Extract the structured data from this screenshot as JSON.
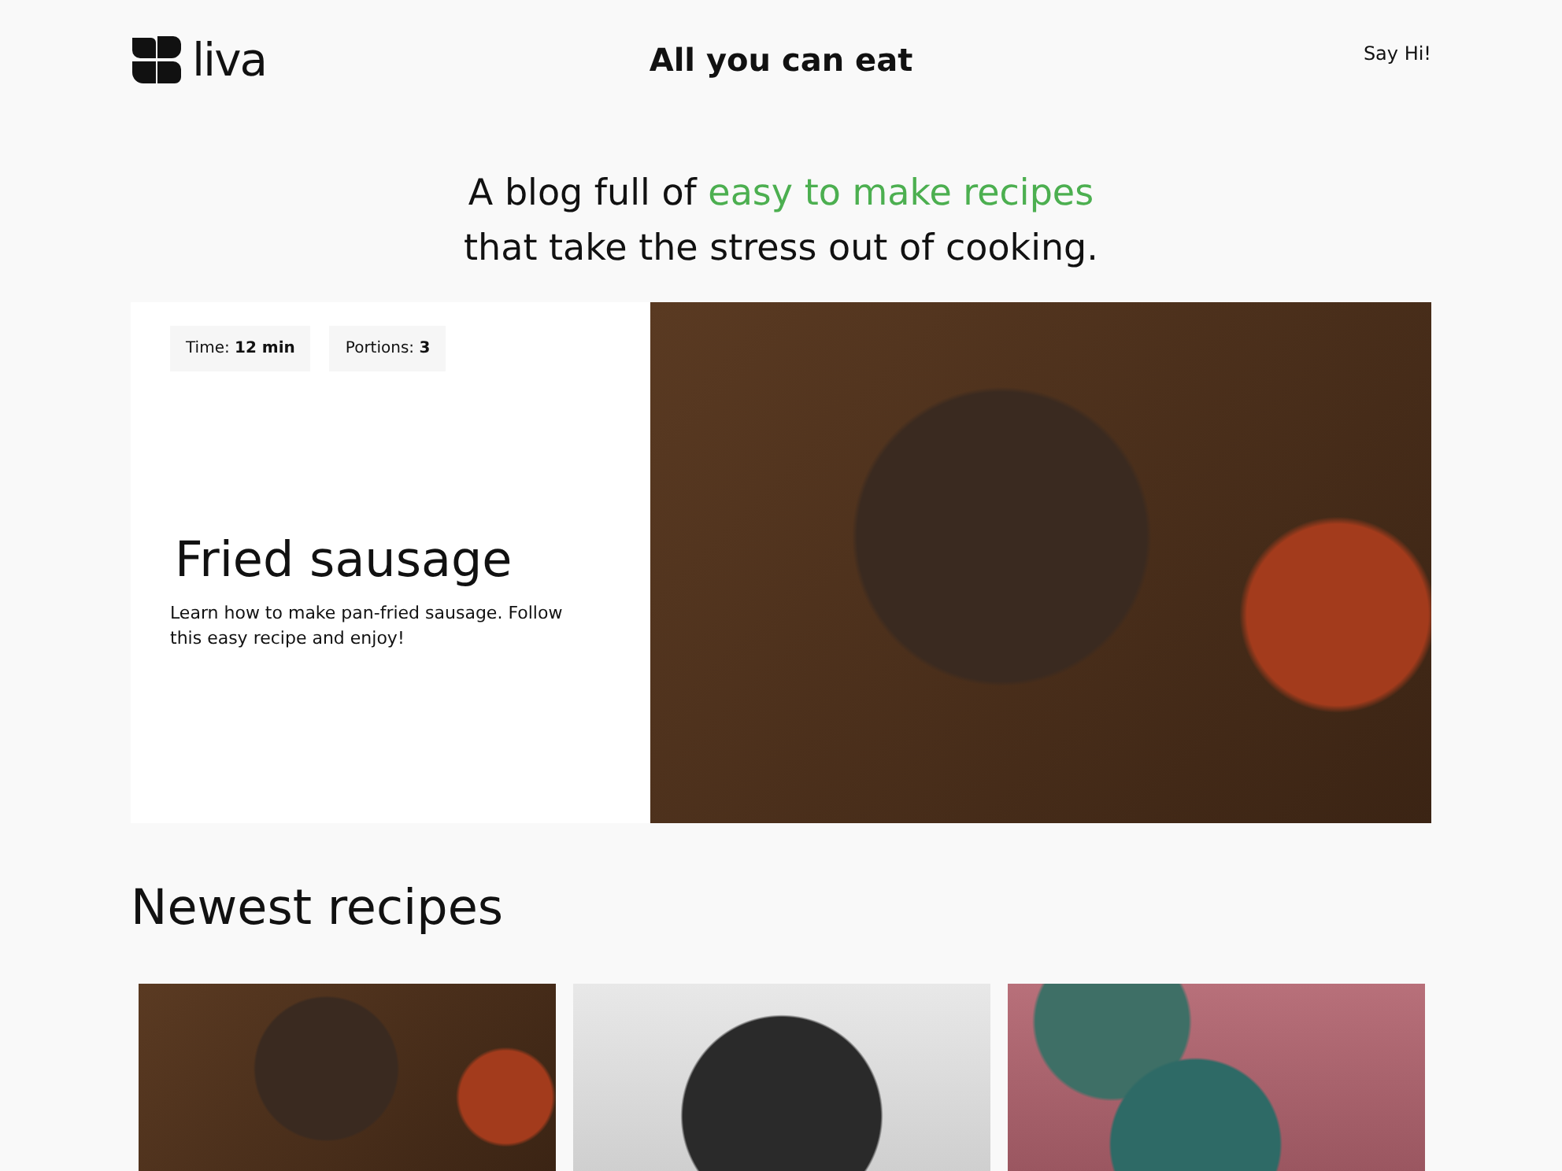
{
  "header": {
    "logo": "liva",
    "title": "All you can eat",
    "link": "Say Hi!"
  },
  "tagline": {
    "lead": "A blog full of",
    "highlight": "easy to make recipes",
    "rest": "that take the stress out of cooking."
  },
  "featured": {
    "meta": [
      "Time: **12 min**",
      "Portions: **3**"
    ],
    "title": "Fried sausage",
    "description": "Learn how to make pan-fried sausage. Follow this easy recipe and enjoy!"
  },
  "newest": {
    "heading": "Newest recipes",
    "cards": [
      {
        "kind": "sausage"
      },
      {
        "kind": "eggs-pan"
      },
      {
        "kind": "eggs-bowl"
      }
    ]
  }
}
